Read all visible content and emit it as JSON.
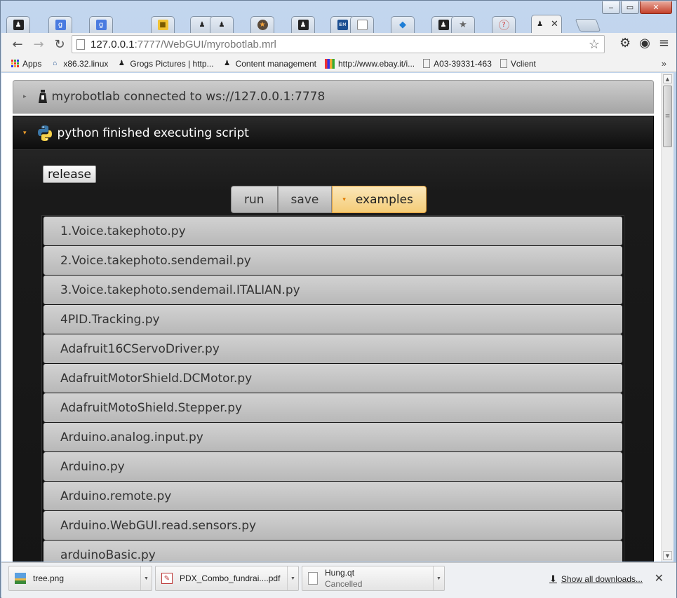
{
  "window": {
    "minimize": "‒",
    "maximize": "▭",
    "close": "✕"
  },
  "tabs": {
    "active_close": "✕",
    "items": [
      {
        "icon": "robot-icon"
      },
      {
        "icon": "google-icon",
        "glyph": "g"
      },
      {
        "icon": "google-icon",
        "glyph": "g"
      },
      {
        "icon": "package-icon"
      },
      {
        "icon": "robot-icon"
      },
      {
        "icon": "robot-icon"
      },
      {
        "icon": "circle-star-icon"
      },
      {
        "icon": "robot-icon"
      },
      {
        "icon": "ibm-icon",
        "glyph": "IBM"
      },
      {
        "icon": "page-icon"
      },
      {
        "icon": "dropbox-icon"
      },
      {
        "icon": "robot-icon"
      },
      {
        "icon": "star-icon"
      },
      {
        "icon": "help-icon"
      },
      {
        "icon": "robot-icon"
      }
    ]
  },
  "toolbar": {
    "back": "←",
    "forward": "→",
    "reload": "↻",
    "url_host": "127.0.0.1",
    "url_rest": ":7777/WebGUI/myrobotlab.mrl",
    "star": "☆",
    "settings": "⚙",
    "broadcast": "◉",
    "menu": "≡"
  },
  "bookmarks": {
    "items": [
      "Apps",
      "x86.32.linux",
      "Grogs Pictures | http...",
      "Content management",
      "http://www.ebay.it/i...",
      "A03-39331-463",
      "Vclient"
    ],
    "more": "»"
  },
  "page": {
    "panel_runtime": {
      "title": "myrobotlab connected to ws://127.0.0.1:7778",
      "toggle": "▸"
    },
    "panel_python": {
      "title": "python finished executing script",
      "toggle": "▾"
    },
    "release_label": "release",
    "run_label": "run",
    "save_label": "save",
    "examples_label": "examples",
    "examples_caret": "▾",
    "examples": [
      "1.Voice.takephoto.py",
      "2.Voice.takephoto.sendemail.py",
      "3.Voice.takephoto.sendemail.ITALIAN.py",
      "4PID.Tracking.py",
      "Adafruit16CServoDriver.py",
      "AdafruitMotorShield.DCMotor.py",
      "AdafruitMotoShield.Stepper.py",
      "Arduino.analog.input.py",
      "Arduino.py",
      "Arduino.remote.py",
      "Arduino.WebGUI.read.sensors.py",
      "arduinoBasic.py"
    ]
  },
  "downloads": {
    "items": [
      {
        "name": "tree.png",
        "status": ""
      },
      {
        "name": "PDX_Combo_fundrai....pdf",
        "status": ""
      },
      {
        "name": "Hung.qt",
        "status": "Cancelled"
      }
    ],
    "show_all": "Show all downloads...",
    "close": "✕"
  },
  "colors": {
    "accent": "#f4a12b",
    "panel_dark": "#1e1e1e",
    "selected_button": "#f4cc77"
  }
}
